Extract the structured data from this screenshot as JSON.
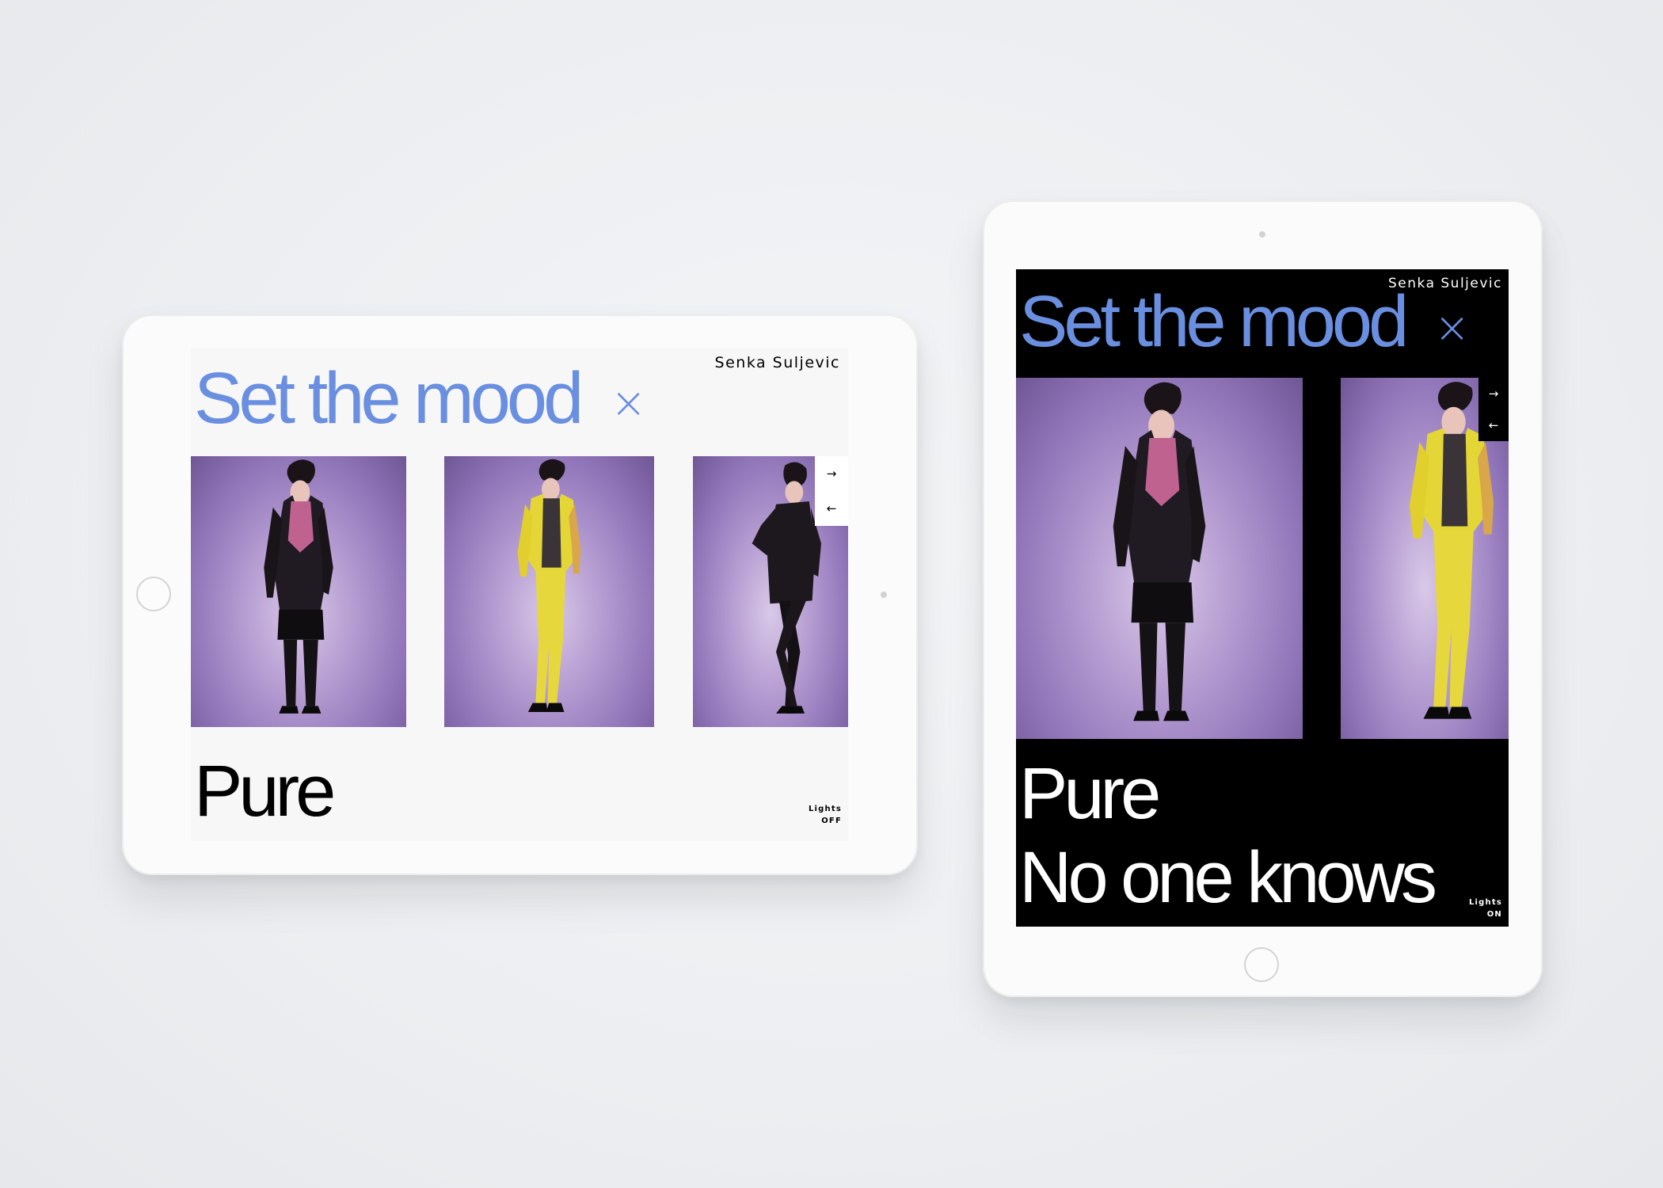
{
  "landscape": {
    "author": "Senka Suljevic",
    "headline": "Set the mood",
    "close": "×",
    "section_title": "Pure",
    "next_arrow": "→",
    "prev_arrow": "←",
    "lights_label": "Lights",
    "lights_state": "OFF",
    "theme": {
      "background": "#f7f7f7",
      "text": "#000000",
      "accent": "#6a8fe0"
    }
  },
  "portrait": {
    "author": "Senka Suljevic",
    "headline": "Set the mood",
    "close": "×",
    "section_titles": [
      "Pure",
      "No one knows"
    ],
    "next_arrow": "→",
    "prev_arrow": "←",
    "lights_label": "Lights",
    "lights_state": "ON",
    "theme": {
      "background": "#000000",
      "text": "#ffffff",
      "accent": "#6a8fe0"
    }
  },
  "icons": {
    "next": "arrow-right-icon",
    "prev": "arrow-left-icon",
    "close": "close-icon"
  }
}
